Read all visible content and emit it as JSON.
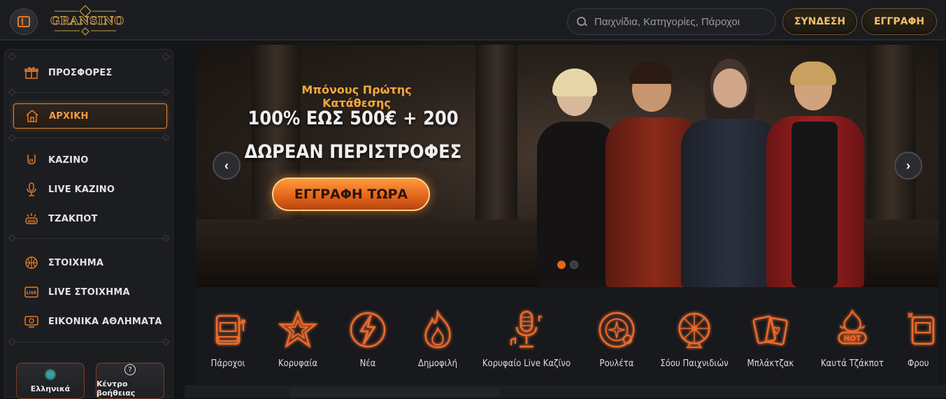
{
  "header": {
    "logo_text": "GRANSINO",
    "search_placeholder": "Παιχνίδια, Κατηγορίες, Πάροχοι",
    "login_label": "ΣΥΝΔΕΣΗ",
    "register_label": "ΕΓΓΡΑΦΗ"
  },
  "sidebar": {
    "items": [
      {
        "label": "ΠΡΟΣΦΟΡΕΣ",
        "icon": "gift-icon"
      },
      {
        "label": "ΑΡΧΙΚΗ",
        "icon": "home-icon",
        "active": true
      },
      {
        "label": "ΚΑΖΙΝΟ",
        "icon": "rock-hand-icon"
      },
      {
        "label": "LIVE ΚΑΖΙΝΟ",
        "icon": "microphone-icon"
      },
      {
        "label": "ΤΖΑΚΠΟΤ",
        "icon": "jackpot-icon"
      },
      {
        "label": "ΣΤΟΙΧΗΜΑ",
        "icon": "basketball-icon"
      },
      {
        "label": "LIVE ΣΤΟΙΧΗΜΑ",
        "icon": "live-badge-icon"
      },
      {
        "label": "ΕΙΚΟΝΙΚΑ ΑΘΛΗΜΑΤΑ",
        "icon": "virtual-sports-icon"
      }
    ],
    "footer": {
      "language_label": "Ελληνικά",
      "help_label": "Κέντρο βοήθειας"
    }
  },
  "hero": {
    "subtitle": "Μπόνους Πρώτης Κατάθεσης",
    "title_line1": "100% ΕΩΣ 500€ + 200",
    "title_line2": "ΔΩΡΕΑΝ ΠΕΡΙΣΤΡΟΦΕΣ",
    "cta_label": "ΕΓΓΡΑΦΗ ΤΩΡΑ",
    "slide_count": 2,
    "active_slide": 1
  },
  "categories": [
    {
      "label": "Πάροχοι",
      "icon": "slot-machine-icon"
    },
    {
      "label": "Κορυφαία",
      "icon": "star-icon"
    },
    {
      "label": "Νέα",
      "icon": "lightning-icon"
    },
    {
      "label": "Δημοφιλή",
      "icon": "fire-icon"
    },
    {
      "label": "Κορυφαίο Live Καζίνο",
      "icon": "microphone-icon"
    },
    {
      "label": "Ρουλέτα",
      "icon": "roulette-icon"
    },
    {
      "label": "Σόου Παιχνιδιών",
      "icon": "wheel-icon"
    },
    {
      "label": "Μπλάκτζακ",
      "icon": "cards-icon"
    },
    {
      "label": "Καυτά Τζάκποτ",
      "icon": "hot-icon"
    },
    {
      "label": "Φρου",
      "icon": "fruit-slot-icon"
    }
  ],
  "colors": {
    "accent": "#e07a2a",
    "gold": "#f3c069",
    "background": "#141517"
  }
}
